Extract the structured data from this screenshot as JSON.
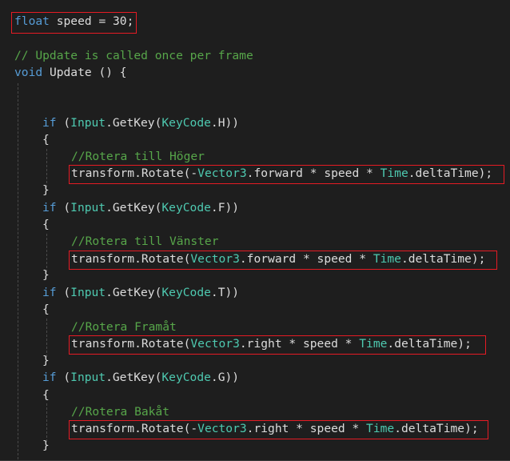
{
  "code": {
    "field_decl": {
      "kw": "float",
      "rest": " speed = 30;"
    },
    "comment_update": "// Update is called once per frame",
    "method_decl": {
      "kw": "void",
      "rest": " Update () {"
    },
    "blocks": [
      {
        "if_kw": "if",
        "open": " (",
        "input_type": "Input",
        "getkey": ".GetKey(",
        "keycode_type": "KeyCode",
        "key": ".H))",
        "brace_open": "{",
        "comment": "//Rotera till Höger",
        "stmt": {
          "head": "transform.Rotate(-",
          "vec_type": "Vector3",
          "member": ".forward * speed * ",
          "time_type": "Time",
          "tail": ".deltaTime);"
        },
        "brace_close": "}"
      },
      {
        "if_kw": "if",
        "open": " (",
        "input_type": "Input",
        "getkey": ".GetKey(",
        "keycode_type": "KeyCode",
        "key": ".F))",
        "brace_open": "{",
        "comment": "//Rotera till Vänster",
        "stmt": {
          "head": "transform.Rotate(",
          "vec_type": "Vector3",
          "member": ".forward * speed * ",
          "time_type": "Time",
          "tail": ".deltaTime);"
        },
        "brace_close": "}"
      },
      {
        "if_kw": "if",
        "open": " (",
        "input_type": "Input",
        "getkey": ".GetKey(",
        "keycode_type": "KeyCode",
        "key": ".T))",
        "brace_open": "{",
        "comment": "//Rotera Framåt",
        "stmt": {
          "head": "transform.Rotate(",
          "vec_type": "Vector3",
          "member": ".right * speed * ",
          "time_type": "Time",
          "tail": ".deltaTime);"
        },
        "brace_close": "}"
      },
      {
        "if_kw": "if",
        "open": " (",
        "input_type": "Input",
        "getkey": ".GetKey(",
        "keycode_type": "KeyCode",
        "key": ".G))",
        "brace_open": "{",
        "comment": "//Rotera Bakåt",
        "stmt": {
          "head": "transform.Rotate(-",
          "vec_type": "Vector3",
          "member": ".right * speed * ",
          "time_type": "Time",
          "tail": ".deltaTime);"
        },
        "brace_close": "}"
      }
    ]
  },
  "colors": {
    "background": "#1e1e1e",
    "keyword": "#569cd6",
    "type": "#4ec9b0",
    "comment": "#57a64a",
    "plain": "#dcdcdc",
    "highlight_box": "#e51b24"
  }
}
